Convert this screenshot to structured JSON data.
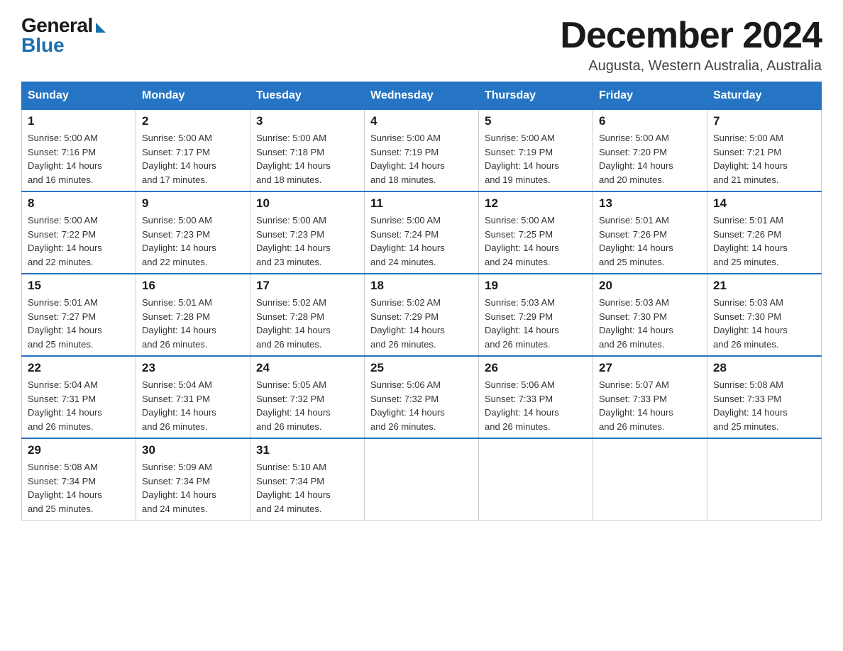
{
  "logo": {
    "general": "General",
    "blue": "Blue",
    "arrow": "▶"
  },
  "title": "December 2024",
  "subtitle": "Augusta, Western Australia, Australia",
  "days_of_week": [
    "Sunday",
    "Monday",
    "Tuesday",
    "Wednesday",
    "Thursday",
    "Friday",
    "Saturday"
  ],
  "weeks": [
    [
      {
        "day": "1",
        "sunrise": "5:00 AM",
        "sunset": "7:16 PM",
        "daylight": "14 hours and 16 minutes."
      },
      {
        "day": "2",
        "sunrise": "5:00 AM",
        "sunset": "7:17 PM",
        "daylight": "14 hours and 17 minutes."
      },
      {
        "day": "3",
        "sunrise": "5:00 AM",
        "sunset": "7:18 PM",
        "daylight": "14 hours and 18 minutes."
      },
      {
        "day": "4",
        "sunrise": "5:00 AM",
        "sunset": "7:19 PM",
        "daylight": "14 hours and 18 minutes."
      },
      {
        "day": "5",
        "sunrise": "5:00 AM",
        "sunset": "7:19 PM",
        "daylight": "14 hours and 19 minutes."
      },
      {
        "day": "6",
        "sunrise": "5:00 AM",
        "sunset": "7:20 PM",
        "daylight": "14 hours and 20 minutes."
      },
      {
        "day": "7",
        "sunrise": "5:00 AM",
        "sunset": "7:21 PM",
        "daylight": "14 hours and 21 minutes."
      }
    ],
    [
      {
        "day": "8",
        "sunrise": "5:00 AM",
        "sunset": "7:22 PM",
        "daylight": "14 hours and 22 minutes."
      },
      {
        "day": "9",
        "sunrise": "5:00 AM",
        "sunset": "7:23 PM",
        "daylight": "14 hours and 22 minutes."
      },
      {
        "day": "10",
        "sunrise": "5:00 AM",
        "sunset": "7:23 PM",
        "daylight": "14 hours and 23 minutes."
      },
      {
        "day": "11",
        "sunrise": "5:00 AM",
        "sunset": "7:24 PM",
        "daylight": "14 hours and 24 minutes."
      },
      {
        "day": "12",
        "sunrise": "5:00 AM",
        "sunset": "7:25 PM",
        "daylight": "14 hours and 24 minutes."
      },
      {
        "day": "13",
        "sunrise": "5:01 AM",
        "sunset": "7:26 PM",
        "daylight": "14 hours and 25 minutes."
      },
      {
        "day": "14",
        "sunrise": "5:01 AM",
        "sunset": "7:26 PM",
        "daylight": "14 hours and 25 minutes."
      }
    ],
    [
      {
        "day": "15",
        "sunrise": "5:01 AM",
        "sunset": "7:27 PM",
        "daylight": "14 hours and 25 minutes."
      },
      {
        "day": "16",
        "sunrise": "5:01 AM",
        "sunset": "7:28 PM",
        "daylight": "14 hours and 26 minutes."
      },
      {
        "day": "17",
        "sunrise": "5:02 AM",
        "sunset": "7:28 PM",
        "daylight": "14 hours and 26 minutes."
      },
      {
        "day": "18",
        "sunrise": "5:02 AM",
        "sunset": "7:29 PM",
        "daylight": "14 hours and 26 minutes."
      },
      {
        "day": "19",
        "sunrise": "5:03 AM",
        "sunset": "7:29 PM",
        "daylight": "14 hours and 26 minutes."
      },
      {
        "day": "20",
        "sunrise": "5:03 AM",
        "sunset": "7:30 PM",
        "daylight": "14 hours and 26 minutes."
      },
      {
        "day": "21",
        "sunrise": "5:03 AM",
        "sunset": "7:30 PM",
        "daylight": "14 hours and 26 minutes."
      }
    ],
    [
      {
        "day": "22",
        "sunrise": "5:04 AM",
        "sunset": "7:31 PM",
        "daylight": "14 hours and 26 minutes."
      },
      {
        "day": "23",
        "sunrise": "5:04 AM",
        "sunset": "7:31 PM",
        "daylight": "14 hours and 26 minutes."
      },
      {
        "day": "24",
        "sunrise": "5:05 AM",
        "sunset": "7:32 PM",
        "daylight": "14 hours and 26 minutes."
      },
      {
        "day": "25",
        "sunrise": "5:06 AM",
        "sunset": "7:32 PM",
        "daylight": "14 hours and 26 minutes."
      },
      {
        "day": "26",
        "sunrise": "5:06 AM",
        "sunset": "7:33 PM",
        "daylight": "14 hours and 26 minutes."
      },
      {
        "day": "27",
        "sunrise": "5:07 AM",
        "sunset": "7:33 PM",
        "daylight": "14 hours and 26 minutes."
      },
      {
        "day": "28",
        "sunrise": "5:08 AM",
        "sunset": "7:33 PM",
        "daylight": "14 hours and 25 minutes."
      }
    ],
    [
      {
        "day": "29",
        "sunrise": "5:08 AM",
        "sunset": "7:34 PM",
        "daylight": "14 hours and 25 minutes."
      },
      {
        "day": "30",
        "sunrise": "5:09 AM",
        "sunset": "7:34 PM",
        "daylight": "14 hours and 24 minutes."
      },
      {
        "day": "31",
        "sunrise": "5:10 AM",
        "sunset": "7:34 PM",
        "daylight": "14 hours and 24 minutes."
      },
      null,
      null,
      null,
      null
    ]
  ],
  "labels": {
    "sunrise": "Sunrise:",
    "sunset": "Sunset:",
    "daylight": "Daylight:"
  }
}
